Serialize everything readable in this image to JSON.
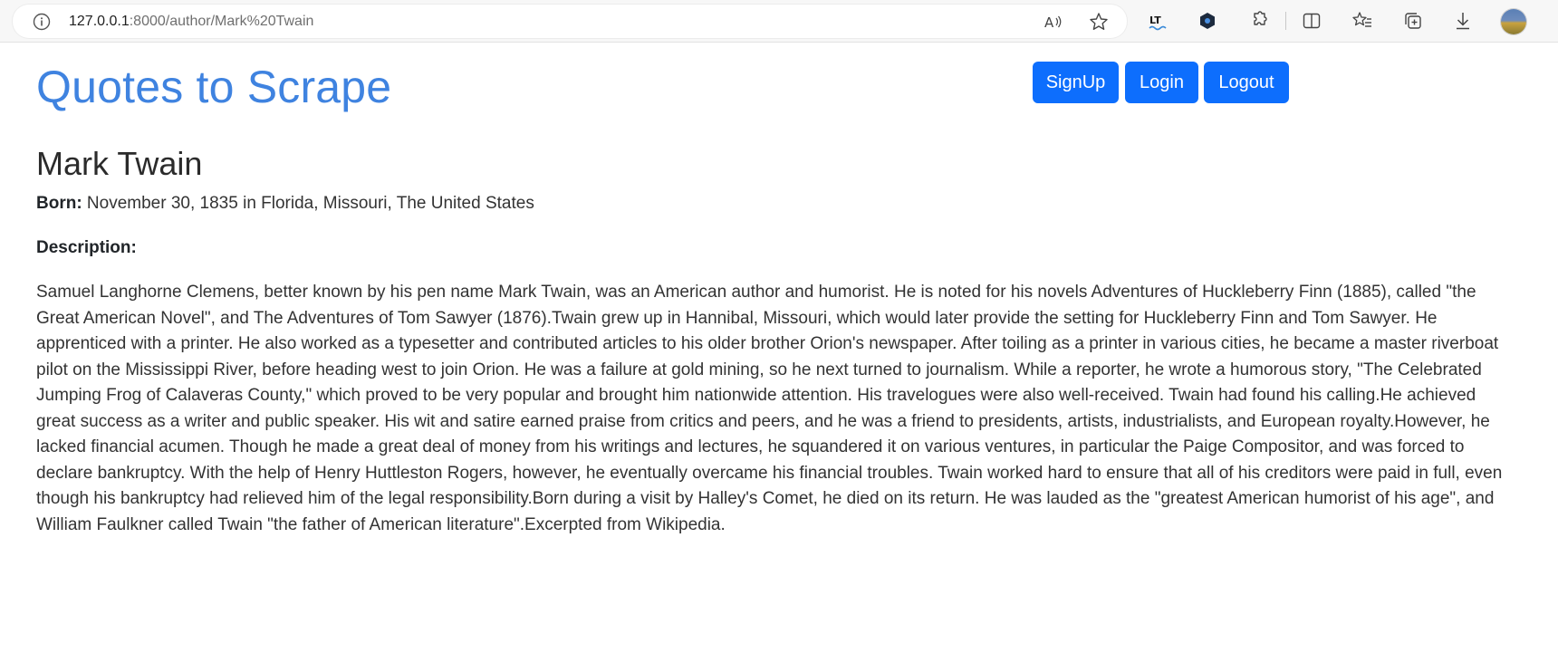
{
  "browser": {
    "url_host": "127.0.0.1",
    "url_rest": ":8000/author/Mark%20Twain",
    "icons": [
      "info-icon",
      "read-aloud-icon",
      "favorite-star-icon",
      "languagetool-icon",
      "shield-extension-icon",
      "extensions-icon",
      "split-screen-icon",
      "favorites-icon",
      "collections-icon",
      "downloads-icon",
      "profile-avatar"
    ]
  },
  "site": {
    "title": "Quotes to Scrape",
    "accent_color": "#3f83e0",
    "button_color": "#0d6efd"
  },
  "nav": {
    "signup_label": "SignUp",
    "login_label": "Login",
    "logout_label": "Logout"
  },
  "author": {
    "name": "Mark Twain",
    "born_label": "Born:",
    "born_value": " November 30, 1835 in Florida, Missouri, The United States",
    "description_label": "Description:",
    "description": "Samuel Langhorne Clemens, better known by his pen name Mark Twain, was an American author and humorist. He is noted for his novels Adventures of Huckleberry Finn (1885), called \"the Great American Novel\", and The Adventures of Tom Sawyer (1876).Twain grew up in Hannibal, Missouri, which would later provide the setting for Huckleberry Finn and Tom Sawyer. He apprenticed with a printer. He also worked as a typesetter and contributed articles to his older brother Orion's newspaper. After toiling as a printer in various cities, he became a master riverboat pilot on the Mississippi River, before heading west to join Orion. He was a failure at gold mining, so he next turned to journalism. While a reporter, he wrote a humorous story, \"The Celebrated Jumping Frog of Calaveras County,\" which proved to be very popular and brought him nationwide attention. His travelogues were also well-received. Twain had found his calling.He achieved great success as a writer and public speaker. His wit and satire earned praise from critics and peers, and he was a friend to presidents, artists, industrialists, and European royalty.However, he lacked financial acumen. Though he made a great deal of money from his writings and lectures, he squandered it on various ventures, in particular the Paige Compositor, and was forced to declare bankruptcy. With the help of Henry Huttleston Rogers, however, he eventually overcame his financial troubles. Twain worked hard to ensure that all of his creditors were paid in full, even though his bankruptcy had relieved him of the legal responsibility.Born during a visit by Halley's Comet, he died on its return. He was lauded as the \"greatest American humorist of his age\", and William Faulkner called Twain \"the father of American literature\".Excerpted from Wikipedia."
  }
}
